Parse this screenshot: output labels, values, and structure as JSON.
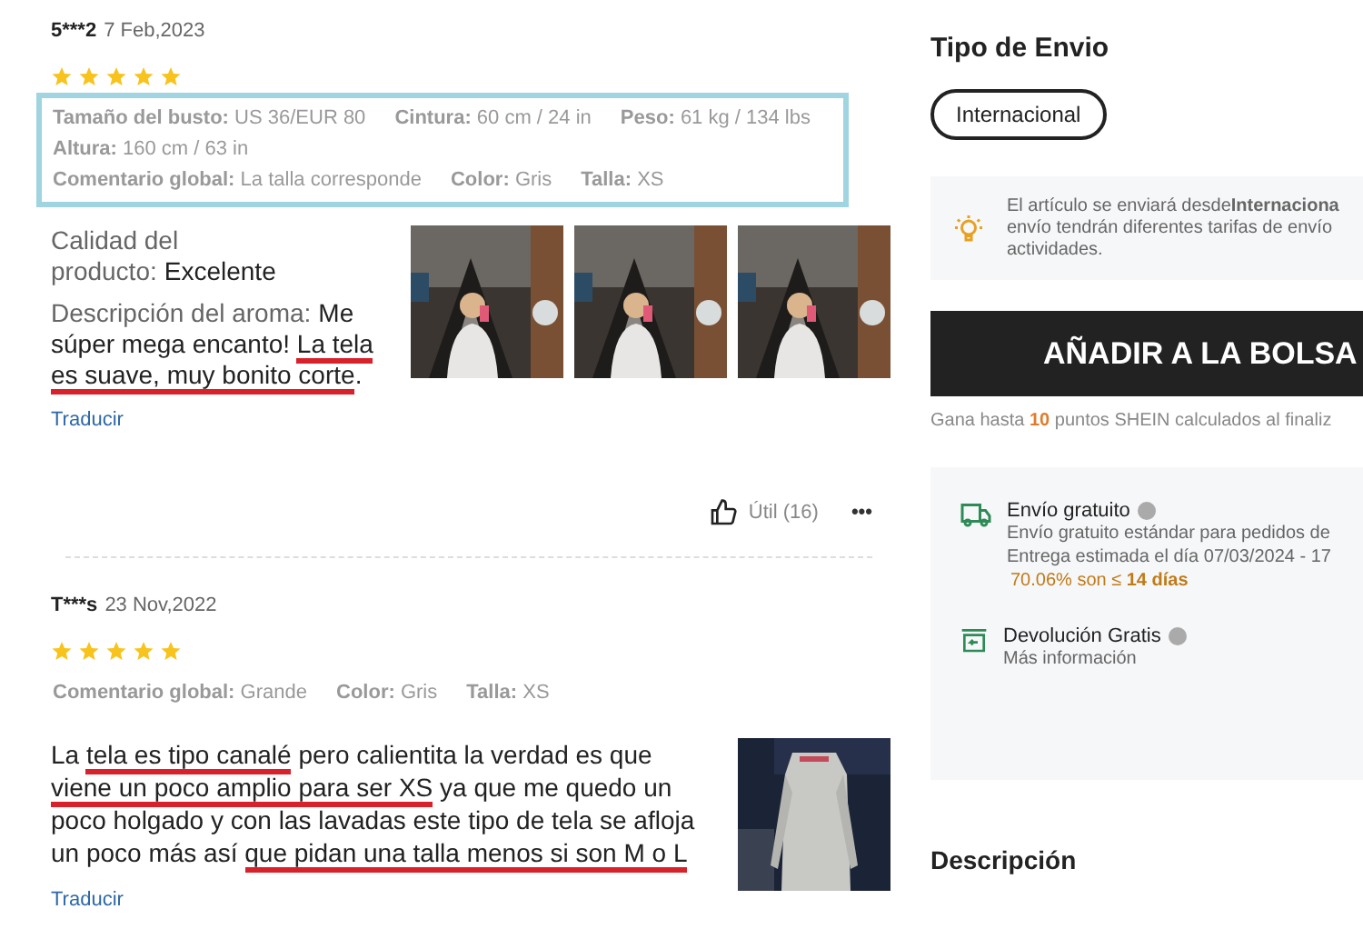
{
  "reviews": [
    {
      "user": "5***2",
      "date": "7 Feb,2023",
      "stars": 5,
      "attribute_rows": [
        [
          {
            "label": "Tamaño del busto:",
            "value": "US 36/EUR 80"
          },
          {
            "label": "Cintura:",
            "value": "60 cm / 24 in"
          },
          {
            "label": "Peso:",
            "value": "61 kg / 134 lbs"
          }
        ],
        [
          {
            "label": "Altura:",
            "value": "160 cm / 63 in"
          }
        ],
        [
          {
            "label": "Comentario global:",
            "value": "La talla corresponde"
          },
          {
            "label": "Color:",
            "value": "Gris"
          },
          {
            "label": "Talla:",
            "value": "XS"
          }
        ]
      ],
      "highlighted": true,
      "paragraphs": [
        {
          "label": "Calidad del producto:",
          "segments": [
            {
              "text": "Excelente",
              "underlined": false
            }
          ]
        },
        {
          "label": "Descripción del aroma:",
          "segments": [
            {
              "text": "Me súper mega encanto! ",
              "underlined": false
            },
            {
              "text": "La tela es suave, muy bonito corte",
              "underlined": true
            },
            {
              "text": ".",
              "underlined": false
            }
          ]
        }
      ],
      "photos": [
        {
          "kind": "picture"
        },
        {
          "kind": "picture"
        },
        {
          "kind": "picture"
        }
      ],
      "translate": "Traducir",
      "helpful": "Útil (16)",
      "more": "•••"
    },
    {
      "user": "T***s",
      "date": "23 Nov,2022",
      "stars": 5,
      "attribute_rows": [
        [
          {
            "label": "Comentario global:",
            "value": "Grande"
          },
          {
            "label": "Color:",
            "value": "Gris"
          },
          {
            "label": "Talla:",
            "value": "XS"
          }
        ]
      ],
      "highlighted": false,
      "paragraphs": [
        {
          "segments": [
            {
              "text": "La ",
              "underlined": false
            },
            {
              "text": "tela es tipo canalé",
              "underlined": true
            },
            {
              "text": " pero calientita la verdad es que ",
              "underlined": false
            },
            {
              "text": "viene un poco amplio para ser XS",
              "underlined": true
            },
            {
              "text": " ya que me quedo un poco holgado y con las lavadas este tipo de tela se afloja un poco más así ",
              "underlined": false
            },
            {
              "text": "que pidan una talla menos si son M o L",
              "underlined": true
            }
          ]
        }
      ],
      "photos": [
        {
          "kind": "picture"
        }
      ],
      "translate": "Traducir"
    }
  ],
  "shipping": {
    "title": "Tipo de Envio",
    "options": [
      {
        "label": "Internacional",
        "selected": true
      }
    ],
    "notice": [
      "El artículo se enviará desde**Internaciona**",
      "envío tendrán diferentes tarifas de envío",
      "actividades."
    ]
  },
  "add_to_bag": "AÑADIR A LA BOLSA",
  "points": "Gana hasta **10** puntos SHEIN calculados al finaliz",
  "services": [
    {
      "kind": "truck",
      "title": "Envío gratuito",
      "lines": [
        "Envío gratuito estándar para pedidos de",
        "Entrega estimada el día 07/03/2024 - 17"
      ],
      "highlight": "70.06% son ≤ **14 días**"
    },
    {
      "kind": "return",
      "title": "Devolución Gratis",
      "lines": [
        "Más información"
      ]
    }
  ],
  "description_heading": "Descripción"
}
